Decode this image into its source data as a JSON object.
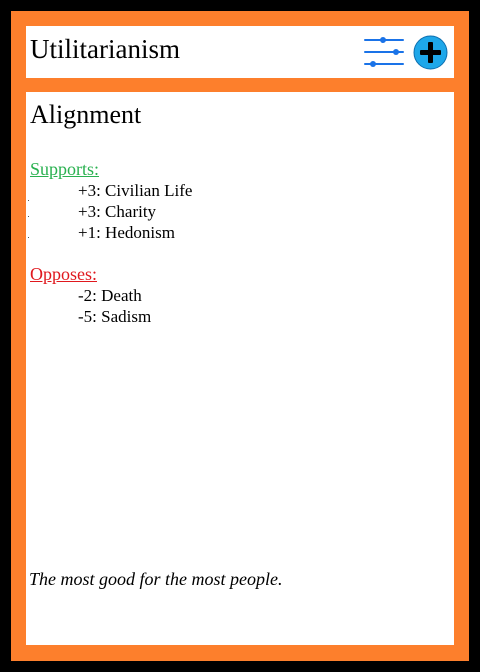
{
  "card": {
    "title": "Utilitarianism",
    "section_title": "Alignment",
    "supports": {
      "label": "Supports:",
      "items": [
        "+3: Civilian Life",
        "+3: Charity",
        "+1: Hedonism"
      ]
    },
    "opposes": {
      "label": "Opposes:",
      "items": [
        "-2: Death",
        "-5: Sadism"
      ]
    },
    "flavor_text": "The most good for the most people."
  },
  "icons": {
    "sliders": "sliders-icon",
    "add": "plus-circle-icon"
  },
  "colors": {
    "border": "#fd7f2c",
    "frame": "#000000",
    "supports": "#2ab150",
    "opposes": "#e0181e",
    "icon_blue": "#1a73e8",
    "add_fill": "#1ea7e9"
  }
}
